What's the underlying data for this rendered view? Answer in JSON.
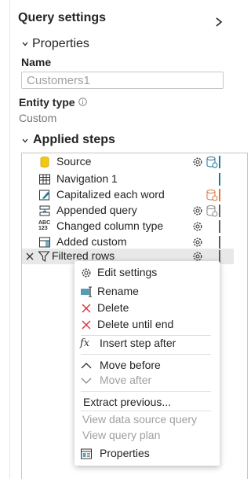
{
  "panel": {
    "title": "Query settings",
    "properties_label": "Properties",
    "name_label": "Name",
    "name_value": "Customers1",
    "entity_type_label": "Entity type",
    "entity_type_value": "Custom",
    "applied_steps_label": "Applied steps"
  },
  "steps": [
    {
      "label": "Source",
      "icon": "database-icon"
    },
    {
      "label": "Navigation 1",
      "icon": "table-icon"
    },
    {
      "label": "Capitalized each word",
      "icon": "edit-column-icon"
    },
    {
      "label": "Appended query",
      "icon": "append-icon"
    },
    {
      "label": "Changed column type",
      "icon": "abc-123-icon"
    },
    {
      "label": "Added custom",
      "icon": "custom-column-icon"
    },
    {
      "label": "Filtered rows",
      "icon": "filter-icon"
    }
  ],
  "context_menu": {
    "edit_settings": "Edit settings",
    "rename": "Rename",
    "delete": "Delete",
    "delete_until_end": "Delete until end",
    "insert_step_after": "Insert step after",
    "move_before": "Move before",
    "move_after": "Move after",
    "extract_previous": "Extract previous...",
    "view_data_source_query": "View data source query",
    "view_query_plan": "View query plan",
    "properties": "Properties"
  },
  "colors": {
    "accent_teal": "#1b7a99",
    "warning_orange": "#d9773a",
    "delete_red": "#d13438",
    "db_yellow": "#f2c811"
  }
}
